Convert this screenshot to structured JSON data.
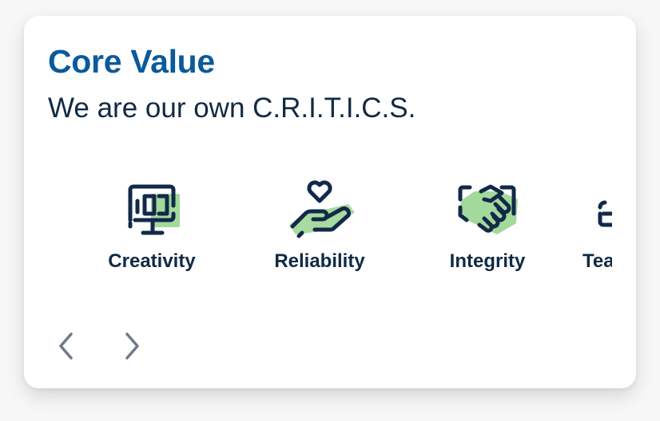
{
  "header": {
    "title": "Core Value",
    "subtitle": "We are our own C.R.I.T.I.C.S."
  },
  "values": [
    {
      "label": "Creativity",
      "icon": "monitor-icon"
    },
    {
      "label": "Reliability",
      "icon": "heart-in-hand-icon"
    },
    {
      "label": "Integrity",
      "icon": "handshake-icon"
    },
    {
      "label": "Tea",
      "icon": "teamwork-icon"
    }
  ],
  "navigation": {
    "prev_icon": "chevron-left-icon",
    "next_icon": "chevron-right-icon"
  },
  "colors": {
    "title": "#0a5a9c",
    "text": "#102a43",
    "icon_stroke": "#12294a",
    "icon_accent": "#a3d99b",
    "nav_arrow": "#6f7a8a"
  }
}
